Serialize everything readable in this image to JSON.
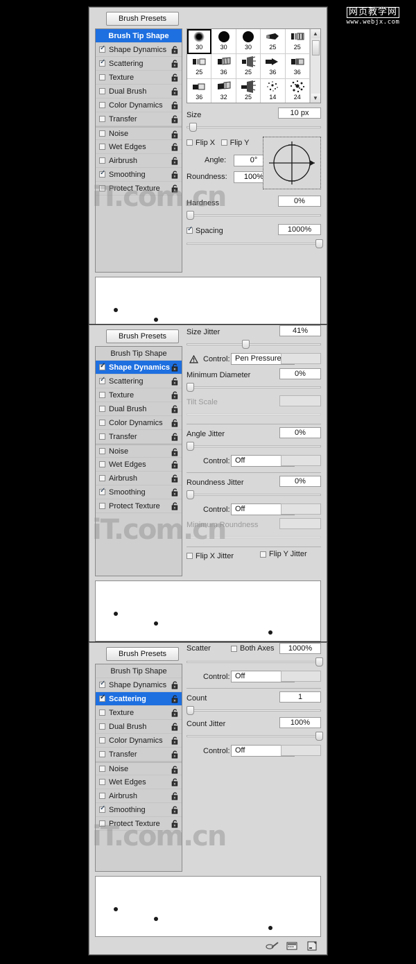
{
  "watermark": {
    "top_cn": "网页教学网",
    "top_en": "www.webjx.com",
    "inline": "iT.com.cn"
  },
  "labels": {
    "brush_presets": "Brush Presets",
    "control": "Control:",
    "px_unit": "px"
  },
  "sidebar_items": [
    {
      "label": "Brush Tip Shape",
      "checkbox": false,
      "checked": false,
      "header": true
    },
    {
      "label": "Shape Dynamics",
      "checkbox": true,
      "checked": true
    },
    {
      "label": "Scattering",
      "checkbox": true,
      "checked": true
    },
    {
      "label": "Texture",
      "checkbox": true,
      "checked": false
    },
    {
      "label": "Dual Brush",
      "checkbox": true,
      "checked": false
    },
    {
      "label": "Color Dynamics",
      "checkbox": true,
      "checked": false
    },
    {
      "label": "Transfer",
      "checkbox": true,
      "checked": false
    },
    {
      "label": "Noise",
      "checkbox": true,
      "checked": false,
      "gap": true
    },
    {
      "label": "Wet Edges",
      "checkbox": true,
      "checked": false
    },
    {
      "label": "Airbrush",
      "checkbox": true,
      "checked": false
    },
    {
      "label": "Smoothing",
      "checkbox": true,
      "checked": true
    },
    {
      "label": "Protect Texture",
      "checkbox": true,
      "checked": false
    }
  ],
  "brush_grid": {
    "cells": [
      {
        "size": "30",
        "shape": "soft-round",
        "selected": true
      },
      {
        "size": "30",
        "shape": "hard-round"
      },
      {
        "size": "30",
        "shape": "hard-round"
      },
      {
        "size": "25",
        "shape": "flat-angle"
      },
      {
        "size": "25",
        "shape": "flat-bristle"
      },
      {
        "size": "25",
        "shape": "flat-blunt"
      },
      {
        "size": "36",
        "shape": "flat-fan"
      },
      {
        "size": "25",
        "shape": "round-fan"
      },
      {
        "size": "36",
        "shape": "point-round"
      },
      {
        "size": "36",
        "shape": "flat-chisel"
      },
      {
        "size": "36",
        "shape": "round-blunt"
      },
      {
        "size": "32",
        "shape": "flat-curve"
      },
      {
        "size": "25",
        "shape": "round-fan2"
      },
      {
        "size": "14",
        "shape": "spatter"
      },
      {
        "size": "24",
        "shape": "spatter-big"
      }
    ],
    "scroll_up_icon": "chevron-up-icon",
    "scroll_down_icon": "chevron-down-icon"
  },
  "panel1": {
    "size": {
      "label": "Size",
      "value": "10 px",
      "slider_pct": 2
    },
    "flip_x": {
      "label": "Flip X",
      "checked": false
    },
    "flip_y": {
      "label": "Flip Y",
      "checked": false
    },
    "angle": {
      "label": "Angle:",
      "value": "0°"
    },
    "roundness": {
      "label": "Roundness:",
      "value": "100%"
    },
    "hardness": {
      "label": "Hardness",
      "value": "0%",
      "slider_pct": 0
    },
    "spacing": {
      "label": "Spacing",
      "value": "1000%",
      "checked": true,
      "slider_pct": 98
    }
  },
  "panel2": {
    "size_jitter": {
      "label": "Size Jitter",
      "value": "41%",
      "slider_pct": 41
    },
    "control1": {
      "label": "Control:",
      "value": "Pen Pressure",
      "warn_icon": "warning-icon"
    },
    "minimum_diameter": {
      "label": "Minimum Diameter",
      "value": "0%",
      "slider_pct": 0
    },
    "tilt_scale": {
      "label": "Tilt Scale",
      "value": "",
      "disabled": true
    },
    "angle_jitter": {
      "label": "Angle Jitter",
      "value": "0%",
      "slider_pct": 0
    },
    "control2": {
      "label": "Control:",
      "value": "Off"
    },
    "roundness_jitter": {
      "label": "Roundness Jitter",
      "value": "0%",
      "slider_pct": 0
    },
    "control3": {
      "label": "Control:",
      "value": "Off"
    },
    "minimum_roundness": {
      "label": "Minimum Roundness",
      "value": "",
      "disabled": true
    },
    "flip_x_jitter": {
      "label": "Flip X Jitter",
      "checked": false
    },
    "flip_y_jitter": {
      "label": "Flip Y Jitter",
      "checked": false
    }
  },
  "panel3": {
    "scatter": {
      "label": "Scatter",
      "value": "1000%",
      "slider_pct": 98
    },
    "both_axes": {
      "label": "Both Axes",
      "checked": false
    },
    "control1": {
      "label": "Control:",
      "value": "Off"
    },
    "count": {
      "label": "Count",
      "value": "1",
      "slider_pct": 0
    },
    "count_jitter": {
      "label": "Count Jitter",
      "value": "100%",
      "slider_pct": 98
    },
    "control2": {
      "label": "Control:",
      "value": "Off"
    }
  },
  "preview": {
    "dots": [
      {
        "x_pct": 8,
        "y_pct": 51,
        "r": 3
      },
      {
        "x_pct": 26,
        "y_pct": 68,
        "r": 3
      },
      {
        "x_pct": 77,
        "y_pct": 82,
        "r": 3
      }
    ]
  },
  "footer_icons": [
    {
      "name": "brush-stroke-icon"
    },
    {
      "name": "toggle-preview-icon"
    },
    {
      "name": "new-brush-icon"
    }
  ]
}
